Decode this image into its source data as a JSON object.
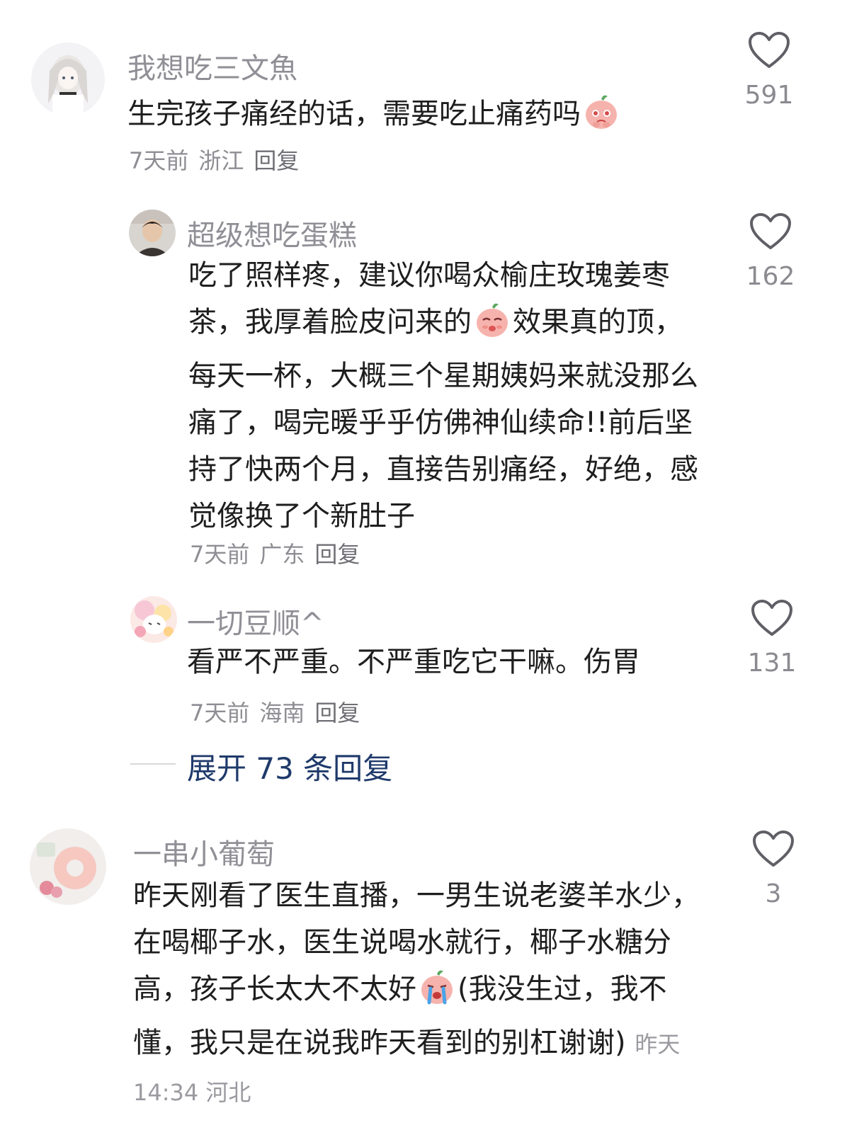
{
  "comments": [
    {
      "username": "我想吃三文魚",
      "text_before": "生完孩子痛经的话，需要吃止痛药吗",
      "emoji": "pleading-emoji",
      "date": "7天前",
      "location": "浙江",
      "reply": "回复",
      "likes": "591"
    },
    {
      "username": "超级想吃蛋糕",
      "text_before": "吃了照样疼，建议你喝众榆庄玫瑰姜枣茶，我厚着脸皮问来的",
      "emoji": "shy-emoji",
      "text_after": "效果真的顶，每天一杯，大概三个星期姨妈来就没那么痛了，喝完暖乎乎仿佛神仙续命!!前后坚持了快两个月，直接告别痛经，好绝，感觉像换了个新肚子",
      "date": "7天前",
      "location": "广东",
      "reply": "回复",
      "likes": "162"
    },
    {
      "username": "一切豆顺^",
      "text_before": "看严不严重。不严重吃它干嘛。伤胃",
      "date": "7天前",
      "location": "海南",
      "reply": "回复",
      "likes": "131"
    },
    {
      "username": "一串小葡萄",
      "text_before": "昨天刚看了医生直播，一男生说老婆羊水少，在喝椰子水，医生说喝水就行，椰子水糖分高，孩子长太大不太好",
      "emoji": "crying-emoji",
      "text_after": "(我没生过，我不懂，我只是在说我昨天看到的别杠谢谢)",
      "date": "昨天 14:34",
      "location": "河北",
      "likes": "3"
    }
  ],
  "expand_replies": "展开 73 条回复",
  "icons": {
    "like": "heart-outline-icon"
  },
  "colors": {
    "username": "#8f8f96",
    "text": "#1e1e1e",
    "meta": "#8e8e94",
    "expand": "#1f3a6b",
    "emoji": "#f4a09a"
  }
}
